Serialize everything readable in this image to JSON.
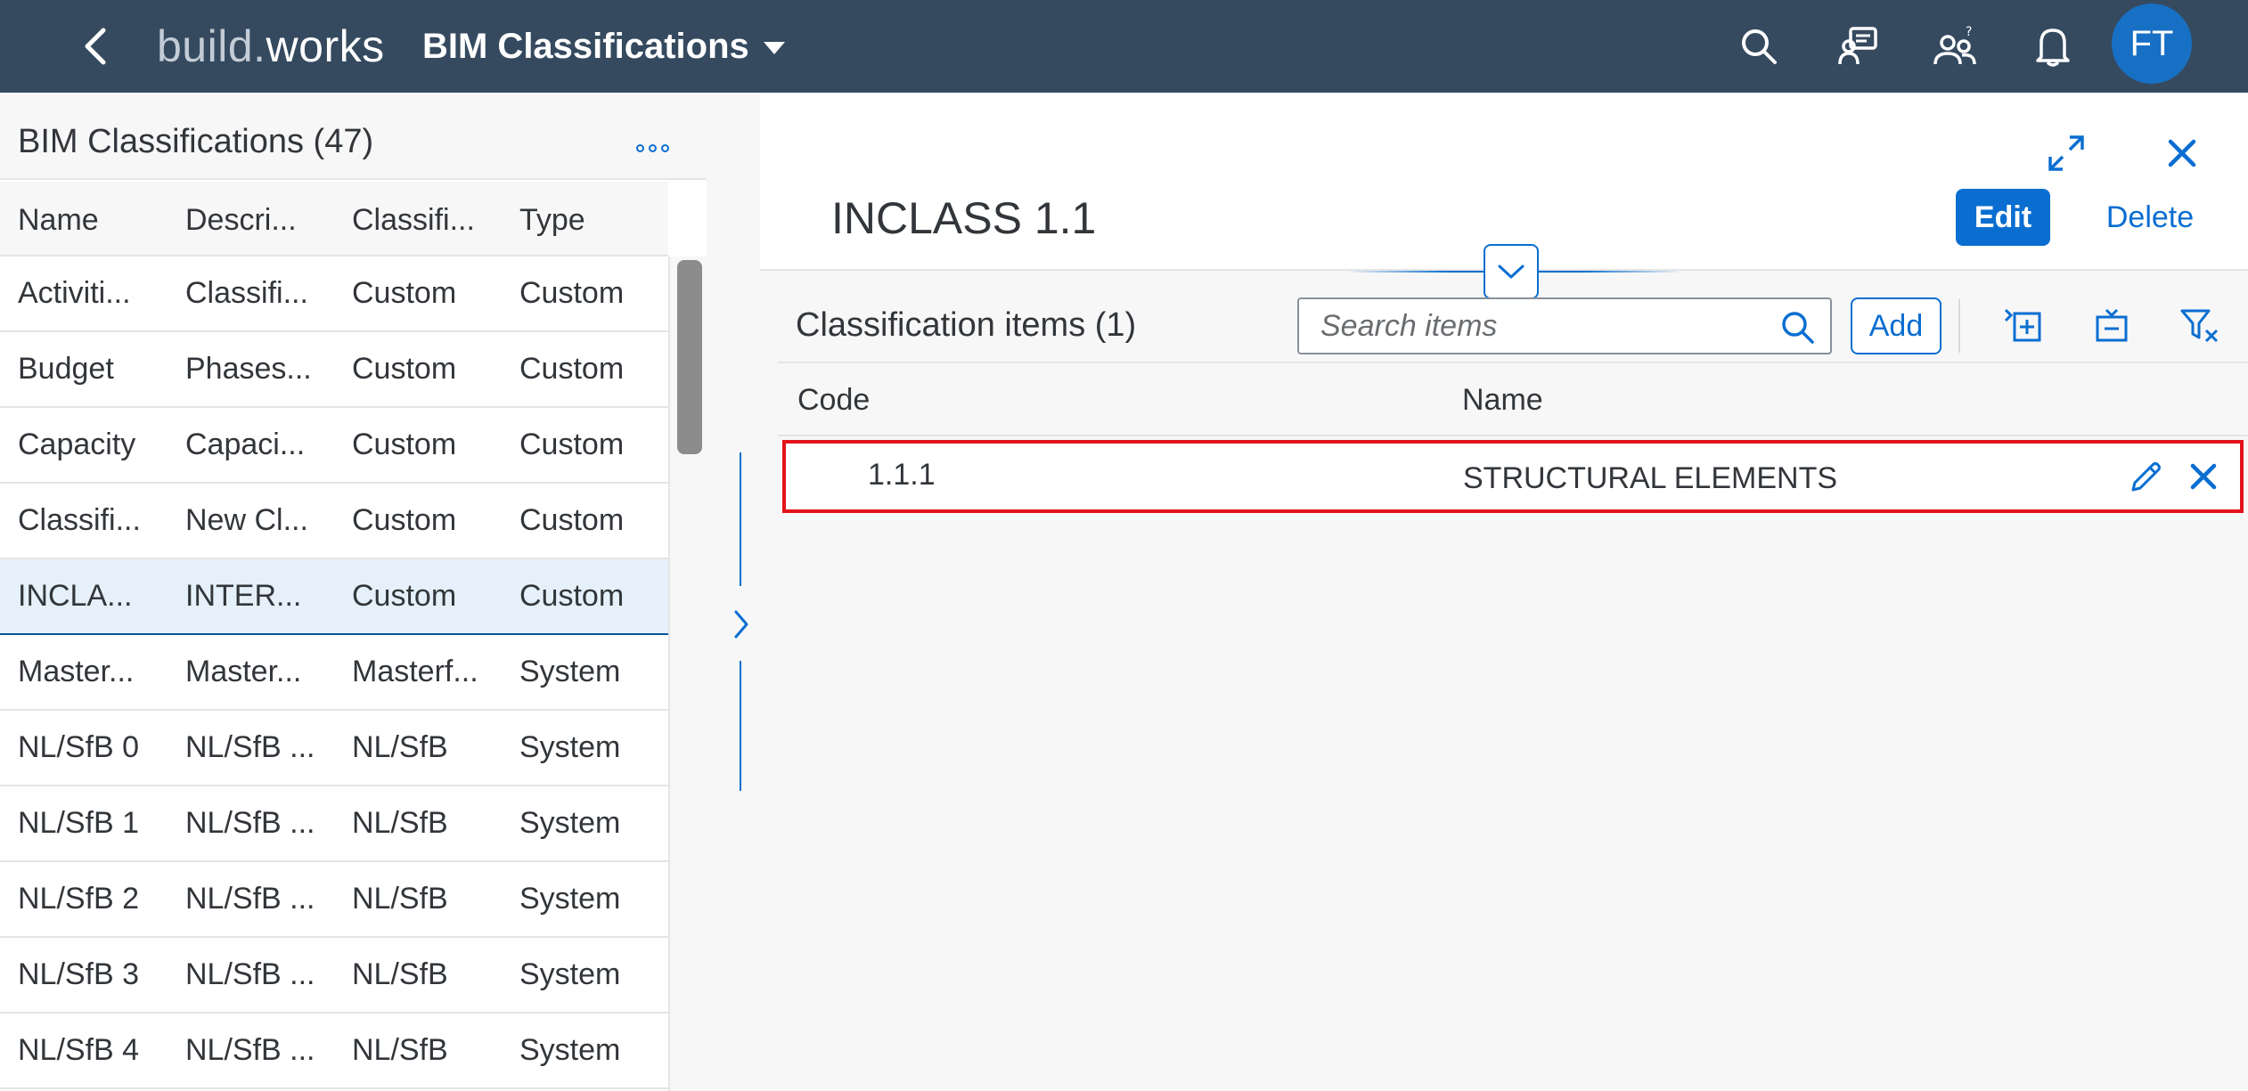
{
  "shell": {
    "logo_prefix": "build.",
    "logo_suffix": "works",
    "app_title": "BIM Classifications",
    "avatar_initials": "FT"
  },
  "list": {
    "title": "BIM Classifications (47)",
    "columns": [
      "Name",
      "Descri...",
      "Classifi...",
      "Type"
    ],
    "rows": [
      {
        "name": "Activiti...",
        "description": "Classifi...",
        "classification": "Custom",
        "type": "Custom"
      },
      {
        "name": "Budget",
        "description": "Phases...",
        "classification": "Custom",
        "type": "Custom"
      },
      {
        "name": "Capacity",
        "description": "Capaci...",
        "classification": "Custom",
        "type": "Custom"
      },
      {
        "name": "Classifi...",
        "description": "New Cl...",
        "classification": "Custom",
        "type": "Custom"
      },
      {
        "name": "INCLA...",
        "description": "INTER...",
        "classification": "Custom",
        "type": "Custom"
      },
      {
        "name": "Master...",
        "description": "Master...",
        "classification": "Masterf...",
        "type": "System"
      },
      {
        "name": "NL/SfB 0",
        "description": "NL/SfB ...",
        "classification": "NL/SfB",
        "type": "System"
      },
      {
        "name": "NL/SfB 1",
        "description": "NL/SfB ...",
        "classification": "NL/SfB",
        "type": "System"
      },
      {
        "name": "NL/SfB 2",
        "description": "NL/SfB ...",
        "classification": "NL/SfB",
        "type": "System"
      },
      {
        "name": "NL/SfB 3",
        "description": "NL/SfB ...",
        "classification": "NL/SfB",
        "type": "System"
      },
      {
        "name": "NL/SfB 4",
        "description": "NL/SfB ...",
        "classification": "NL/SfB",
        "type": "System"
      }
    ]
  },
  "detail": {
    "title": "INCLASS 1.1",
    "edit_label": "Edit",
    "delete_label": "Delete",
    "items_title": "Classification items (1)",
    "search_placeholder": "Search items",
    "add_label": "Add",
    "columns": [
      "Code",
      "Name"
    ],
    "items": [
      {
        "code": "1.1.1",
        "name": "STRUCTURAL ELEMENTS"
      }
    ]
  },
  "icons": {
    "back": "back-icon",
    "search": "search-icon",
    "feedback": "feedback-icon",
    "help": "user-help-icon",
    "notifications": "bell-icon",
    "more": "overflow-icon",
    "fullscreen": "fullscreen-icon",
    "close": "close-icon",
    "collapse": "chevron-down-icon",
    "splitter": "chevron-right-icon",
    "expand_all": "expand-all-icon",
    "collapse_all": "collapse-all-icon",
    "clear_filter": "clear-filter-icon",
    "edit_row": "pencil-icon",
    "delete_row": "close-icon"
  },
  "colors": {
    "shell": "#354a5f",
    "accent": "#0a6ed1",
    "highlight": "#e3131c",
    "selected_row": "#e5f0fa"
  },
  "state": {
    "selected_row_index": 4
  }
}
